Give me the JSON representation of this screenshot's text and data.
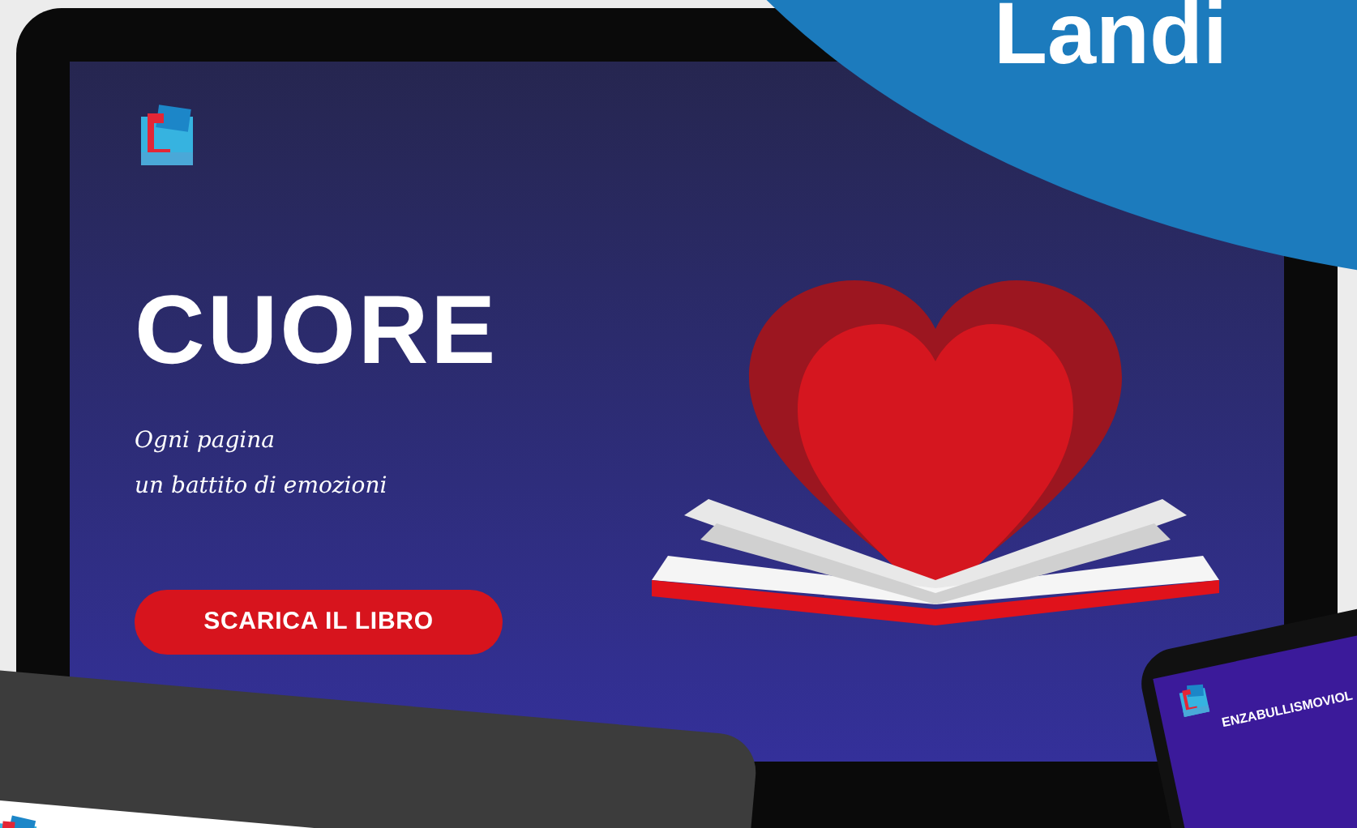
{
  "banner": {
    "text": "Landi"
  },
  "landing": {
    "title": "CUORE",
    "tagline": [
      "Ogni pagina",
      "un battito di emozioni"
    ],
    "button": "SCARICA IL LIBRO"
  },
  "phone": {
    "text": "ENZABULLISMOVIOL"
  }
}
